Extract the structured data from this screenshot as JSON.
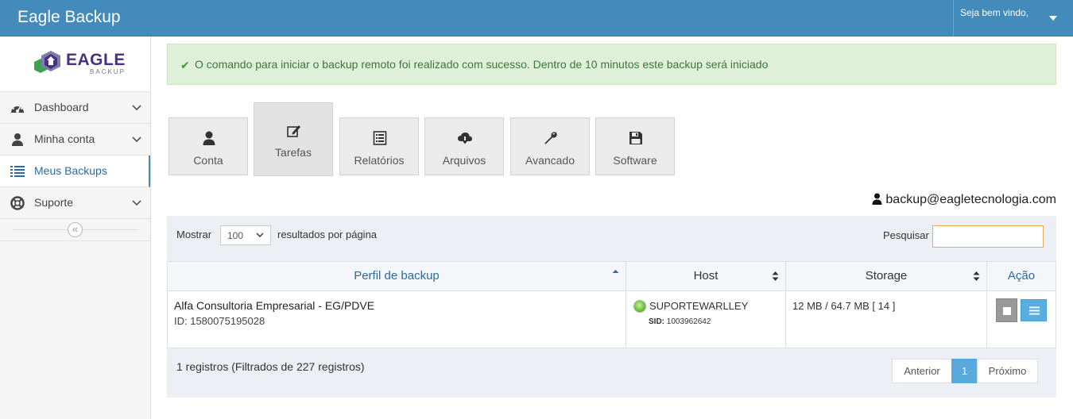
{
  "app": {
    "title": "Eagle Backup",
    "welcome": "Seja bem vindo,"
  },
  "logo": {
    "name": "EAGLE",
    "sub": "BACKUP"
  },
  "sidebar": {
    "items": [
      {
        "label": "Dashboard",
        "icon": "dashboard-icon"
      },
      {
        "label": "Minha conta",
        "icon": "user-icon"
      },
      {
        "label": "Meus Backups",
        "icon": "list-icon"
      },
      {
        "label": "Suporte",
        "icon": "lifebuoy-icon"
      }
    ],
    "collapse_glyph": "«"
  },
  "alert": {
    "message": "O comando para iniciar o backup remoto foi realizado com sucesso. Dentro de 10 minutos este backup será iniciado"
  },
  "tabs": [
    {
      "label": "Conta",
      "icon": "user-icon"
    },
    {
      "label": "Tarefas",
      "icon": "edit-icon"
    },
    {
      "label": "Relatórios",
      "icon": "list-alt-icon"
    },
    {
      "label": "Arquivos",
      "icon": "cloud-download-icon"
    },
    {
      "label": "Avancado",
      "icon": "wrench-icon"
    },
    {
      "label": "Software",
      "icon": "floppy-icon"
    }
  ],
  "account": {
    "email": "backup@eagletecnologia.com"
  },
  "table": {
    "show_label": "Mostrar",
    "page_size": "100",
    "per_page_label": "resultados por página",
    "search_label": "Pesquisar",
    "search_value": "",
    "columns": [
      "Perfil de backup",
      "Host",
      "Storage",
      "Ação"
    ],
    "rows": [
      {
        "profile": "Alfa Consultoria Empresarial - EG/PDVE",
        "id": "ID: 1580075195028",
        "host": "SUPORTEWARLLEY",
        "sid_label": "SID:",
        "sid": "1003962642",
        "storage": "12 MB / 64.7 MB [ 14 ]"
      }
    ],
    "info": "1 registros (Filtrados de 227 registros)",
    "pagination": {
      "prev": "Anterior",
      "current": "1",
      "next": "Próximo"
    }
  }
}
